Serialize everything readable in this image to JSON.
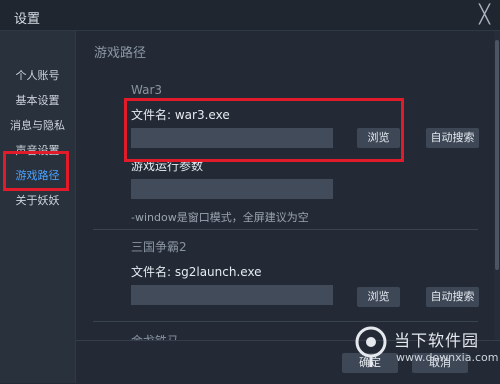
{
  "window": {
    "title": "设置",
    "close_glyph": "╳"
  },
  "sidebar": {
    "items": [
      {
        "label": "个人账号"
      },
      {
        "label": "基本设置"
      },
      {
        "label": "消息与隐私"
      },
      {
        "label": "声音设置"
      },
      {
        "label": "游戏路径"
      },
      {
        "label": "关于妖妖"
      }
    ],
    "active_index": 4
  },
  "main": {
    "section_title": "游戏路径",
    "games": [
      {
        "name": "War3",
        "file_label": "文件名: war3.exe",
        "path_value": "",
        "browse_label": "浏览",
        "autosearch_label": "自动搜索",
        "args_label": "游戏运行参数",
        "args_value": "",
        "args_hint": "-window是窗口模式，全屏建议为空"
      },
      {
        "name": "三国争霸2",
        "file_label": "文件名: sg2launch.exe",
        "path_value": "",
        "browse_label": "浏览",
        "autosearch_label": "自动搜索"
      },
      {
        "name": "金戈铁马"
      }
    ]
  },
  "footer": {
    "ok_label": "确定",
    "cancel_label": "取消"
  },
  "watermark": {
    "text": "当下软件园",
    "url": "www.downxia.com"
  },
  "colors": {
    "accent": "#4aa3ff",
    "highlight": "#e11b2a",
    "background": "#232a35"
  }
}
